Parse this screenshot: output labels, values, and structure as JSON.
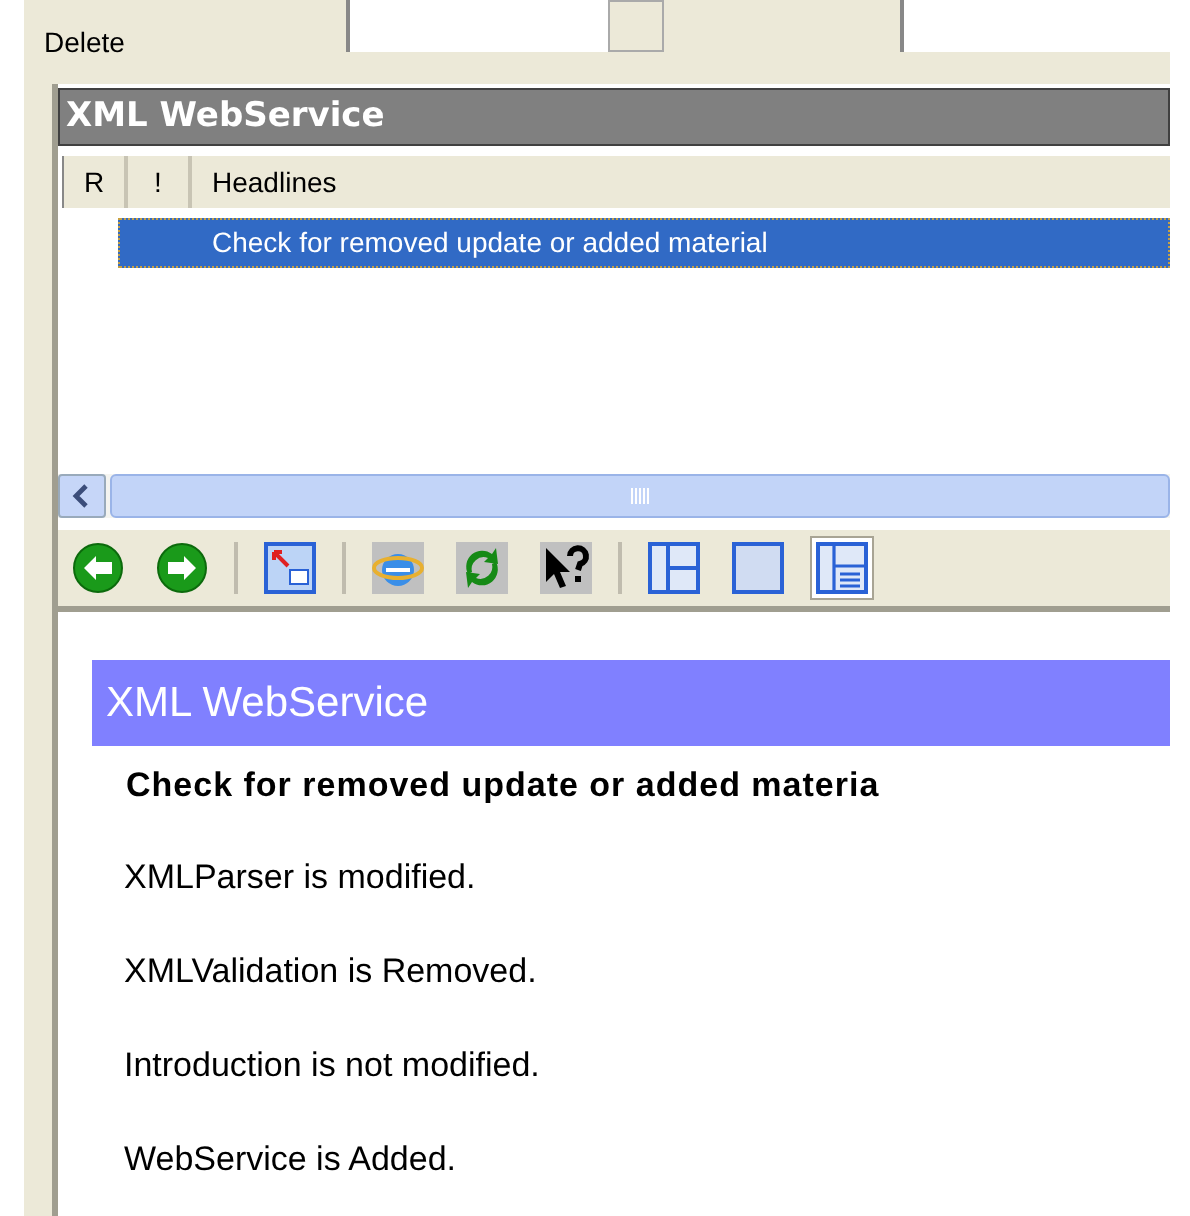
{
  "top_bar": {
    "delete_label": "Delete"
  },
  "panel": {
    "title": "XML WebService"
  },
  "list": {
    "columns": [
      "R",
      "!",
      "Headlines"
    ],
    "rows": [
      {
        "headline": "Check for removed update or added material",
        "selected": true
      }
    ]
  },
  "toolbar": [
    {
      "kind": "back",
      "selected": false
    },
    {
      "kind": "forward",
      "selected": false
    },
    {
      "kind": "separator"
    },
    {
      "kind": "popout",
      "selected": false
    },
    {
      "kind": "separator"
    },
    {
      "kind": "browser",
      "selected": false
    },
    {
      "kind": "refresh",
      "selected": false
    },
    {
      "kind": "help",
      "selected": false
    },
    {
      "kind": "separator"
    },
    {
      "kind": "layout-split",
      "selected": false
    },
    {
      "kind": "layout-single",
      "selected": false
    },
    {
      "kind": "layout-preview",
      "selected": true
    }
  ],
  "preview": {
    "title": "XML WebService",
    "heading": "Check for removed update or added materia",
    "lines": [
      "XMLParser is modified.",
      "XMLValidation is Removed.",
      "Introduction is not modified.",
      "WebService is Added."
    ]
  }
}
